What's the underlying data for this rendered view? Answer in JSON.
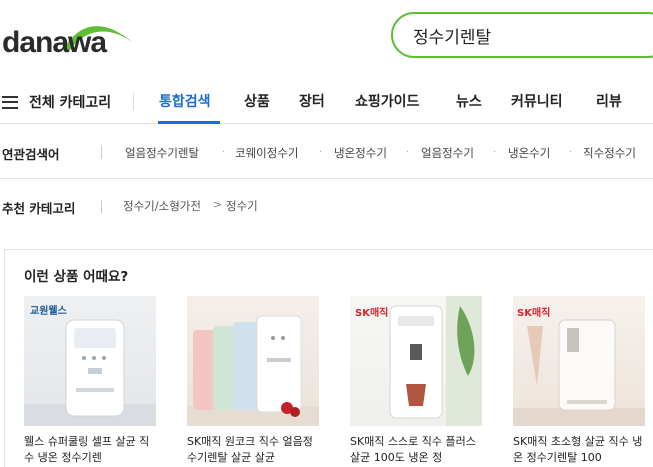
{
  "header": {
    "logo_text": "danawa",
    "search_value": "정수기렌탈"
  },
  "nav": {
    "menu_label": "전체 카테고리",
    "tabs": [
      {
        "label": "통합검색",
        "active": true
      },
      {
        "label": "상품"
      },
      {
        "label": "장터"
      },
      {
        "label": "쇼핑가이드"
      },
      {
        "label": "뉴스"
      },
      {
        "label": "커뮤니티"
      },
      {
        "label": "리뷰"
      }
    ]
  },
  "related": {
    "label": "연관검색어",
    "keywords": [
      "얼음정수기렌탈",
      "코웨이정수기",
      "냉온정수기",
      "얼음정수기",
      "냉온수기",
      "직수정수기"
    ]
  },
  "recommended_category": {
    "label": "추천 카테고리",
    "crumbs": [
      "정수기/소형가전",
      "정수기"
    ],
    "separator": ">"
  },
  "recommend": {
    "title": "이런 상품 어때요?",
    "products": [
      {
        "brand": "교원웰스",
        "name": "웰스 슈퍼쿨링 셀프 살균 직수 냉온 정수기렌"
      },
      {
        "brand": "",
        "name": "SK매직 원코크 직수 얼음정수기렌탈 살균 살균"
      },
      {
        "brand": "SK매직",
        "name": "SK매직 스스로 직수 플러스 살균 100도 냉온 정"
      },
      {
        "brand": "SK매직",
        "name": "SK매직 초소형 살균 직수 냉온 정수기렌탈 100"
      }
    ]
  },
  "colors": {
    "accent_green": "#5fbd36",
    "active_tab_blue": "#1a6dd7"
  }
}
